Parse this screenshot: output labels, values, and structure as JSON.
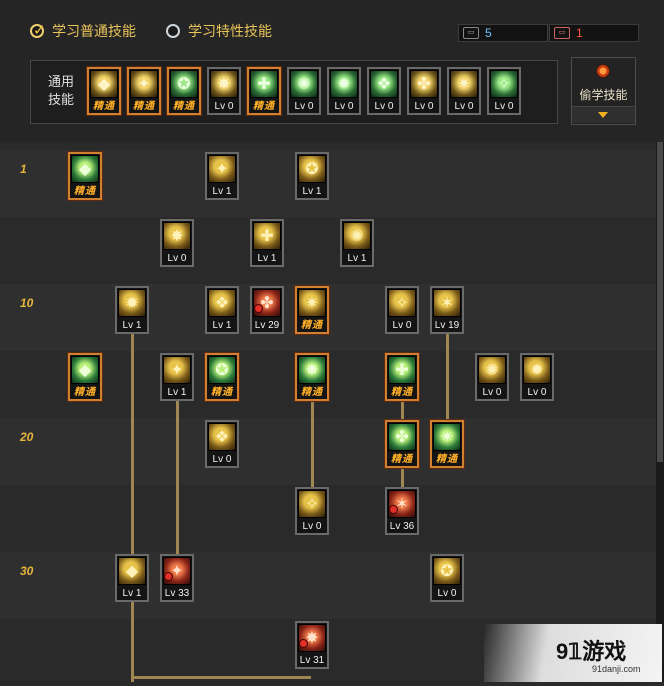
{
  "tabs": [
    {
      "label": "学习普通技能",
      "checked": true
    },
    {
      "label": "学习特性技能",
      "checked": false
    }
  ],
  "points": {
    "sp_value": "5",
    "tp_value": "1"
  },
  "common": {
    "title_line1": "通用",
    "title_line2": "技能",
    "skills": [
      {
        "label": "精通",
        "mastered": true,
        "icon": "sit-icon"
      },
      {
        "label": "精通",
        "mastered": true,
        "icon": "crouch-icon"
      },
      {
        "label": "精通",
        "mastered": true,
        "icon": "run-icon"
      },
      {
        "label": "Lv 0",
        "mastered": false,
        "icon": "wing-icon"
      },
      {
        "label": "精通",
        "mastered": true,
        "icon": "target-icon"
      },
      {
        "label": "Lv 0",
        "mastered": false,
        "icon": "crosshair-icon"
      },
      {
        "label": "Lv 0",
        "mastered": false,
        "icon": "fighter-icon"
      },
      {
        "label": "Lv 0",
        "mastered": false,
        "icon": "bomb-icon"
      },
      {
        "label": "Lv 0",
        "mastered": false,
        "icon": "eye-icon"
      },
      {
        "label": "Lv 0",
        "mastered": false,
        "icon": "muscle-icon"
      },
      {
        "label": "Lv 0",
        "mastered": false,
        "icon": "swing-icon"
      }
    ]
  },
  "steal": {
    "label": "偷学技能"
  },
  "levels": [
    "1",
    "10",
    "20",
    "30"
  ],
  "tree": [
    {
      "label": "精通",
      "mastered": true,
      "color": "green",
      "icon": "kick-icon",
      "lock": false
    },
    {
      "label": "Lv 1",
      "mastered": false,
      "color": "gold",
      "icon": "fist-icon",
      "lock": false
    },
    {
      "label": "Lv 1",
      "mastered": false,
      "color": "gold",
      "icon": "slash-icon",
      "lock": false
    },
    {
      "label": "Lv 0",
      "mastered": false,
      "color": "gold",
      "icon": "grab-icon",
      "lock": false
    },
    {
      "label": "Lv 1",
      "mastered": false,
      "color": "gold",
      "icon": "body-icon",
      "lock": false
    },
    {
      "label": "Lv 1",
      "mastered": false,
      "color": "gold",
      "icon": "burst-icon",
      "lock": false
    },
    {
      "label": "Lv 1",
      "mastered": false,
      "color": "gold",
      "icon": "spark-icon",
      "lock": false
    },
    {
      "label": "Lv 1",
      "mastered": false,
      "color": "gold",
      "icon": "stance-icon",
      "lock": false
    },
    {
      "label": "Lv 29",
      "mastered": false,
      "color": "red",
      "icon": "guard-icon",
      "lock": true
    },
    {
      "label": "精通",
      "mastered": true,
      "color": "gold",
      "icon": "dash-icon",
      "lock": false
    },
    {
      "label": "Lv 0",
      "mastered": false,
      "color": "gold",
      "icon": "lift-icon",
      "lock": false
    },
    {
      "label": "Lv 19",
      "mastered": false,
      "color": "gold",
      "icon": "wave-icon",
      "lock": false
    },
    {
      "label": "精通",
      "mastered": true,
      "color": "green",
      "icon": "star-icon",
      "lock": false
    },
    {
      "label": "Lv 1",
      "mastered": false,
      "color": "gold",
      "icon": "throw-icon",
      "lock": false
    },
    {
      "label": "精通",
      "mastered": true,
      "color": "green",
      "icon": "sweep-icon",
      "lock": false
    },
    {
      "label": "精通",
      "mastered": true,
      "color": "green",
      "icon": "explode-icon",
      "lock": false
    },
    {
      "label": "精通",
      "mastered": true,
      "color": "green",
      "icon": "jump-icon",
      "lock": false
    },
    {
      "label": "Lv 0",
      "mastered": false,
      "color": "gold",
      "icon": "fireball-icon",
      "lock": false
    },
    {
      "label": "Lv 0",
      "mastered": false,
      "color": "gold",
      "icon": "spin-icon",
      "lock": false
    },
    {
      "label": "Lv 0",
      "mastered": false,
      "color": "gold",
      "icon": "punch-icon",
      "lock": false
    },
    {
      "label": "精通",
      "mastered": true,
      "color": "green",
      "icon": "shock-icon",
      "lock": false
    },
    {
      "label": "精通",
      "mastered": true,
      "color": "green",
      "icon": "whirl-icon",
      "lock": false
    },
    {
      "label": "Lv 0",
      "mastered": false,
      "color": "gold",
      "icon": "claw-icon",
      "lock": false
    },
    {
      "label": "Lv 36",
      "mastered": false,
      "color": "red",
      "icon": "awaken-icon",
      "lock": true
    },
    {
      "label": "Lv 1",
      "mastered": false,
      "color": "gold",
      "icon": "armor-icon",
      "lock": false
    },
    {
      "label": "Lv 33",
      "mastered": false,
      "color": "red",
      "icon": "duo-icon",
      "lock": true
    },
    {
      "label": "Lv 0",
      "mastered": false,
      "color": "gold",
      "icon": "slide-icon",
      "lock": false
    },
    {
      "label": "Lv 31",
      "mastered": false,
      "color": "red",
      "icon": "blast-icon",
      "lock": true
    }
  ],
  "watermark": {
    "main": "9𝟙游戏",
    "sub": "91danji.com"
  }
}
